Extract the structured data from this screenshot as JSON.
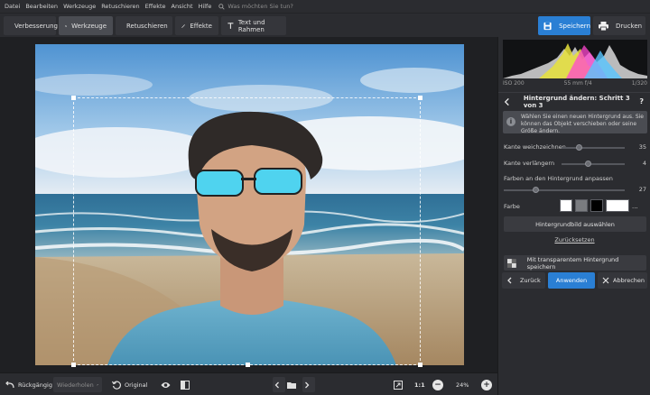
{
  "menu": [
    "Datei",
    "Bearbeiten",
    "Werkzeuge",
    "Retuschieren",
    "Effekte",
    "Ansicht",
    "Hilfe"
  ],
  "search": {
    "placeholder": "Was möchten Sie tun?"
  },
  "toolbar": {
    "tabs": [
      {
        "label": "Verbesserung",
        "icon": "sliders-icon"
      },
      {
        "label": "Werkzeuge",
        "icon": "crop-icon"
      },
      {
        "label": "Retuschieren",
        "icon": "brush-icon"
      },
      {
        "label": "Effekte",
        "icon": "magic-wand-icon"
      },
      {
        "label": "Text und Rahmen",
        "icon": "text-icon"
      }
    ],
    "active_tab": "Werkzeuge",
    "save_label": "Speichern",
    "print_label": "Drucken"
  },
  "exif": {
    "iso": "ISO 200",
    "lens": "55 mm f/4",
    "shutter": "1/320"
  },
  "panel": {
    "step_title": "Hintergrund ändern: Schritt 3 von 3",
    "help": "?",
    "info_text": "Wählen Sie einen neuen Hintergrund aus. Sie können das Objekt verschieben oder seine Größe ändern.",
    "sliders": [
      {
        "label": "Kante weichzeichnen",
        "value": "35",
        "fraction": 0.35
      },
      {
        "label": "Kante verlängern",
        "value": "4",
        "fraction": 0.48
      },
      {
        "label": "Farben an den Hintergrund anpassen",
        "value": "27",
        "fraction": 0.27
      }
    ],
    "color_label": "Farbe",
    "more": "...",
    "choose_bg": "Hintergrundbild auswählen",
    "reset": "Zurücksetzen",
    "save_transparent": "Mit transparentem Hintergrund speichern",
    "back": "Zurück",
    "apply": "Anwenden",
    "cancel": "Abbrechen",
    "accent": "#2a7fd4"
  },
  "bottombar": {
    "undo": "Rückgängig",
    "redo": "Wiederholen",
    "original": "Original",
    "ratio": "1:1",
    "zoom": "24%"
  }
}
